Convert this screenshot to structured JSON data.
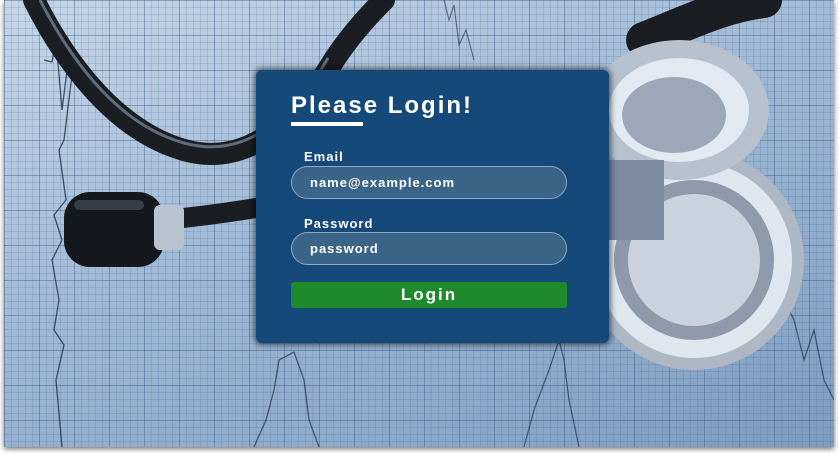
{
  "login": {
    "title": "Please Login!",
    "email_label": "Email",
    "email_value": "name@example.com",
    "password_label": "Password",
    "password_value": "password",
    "login_button": "Login"
  },
  "colors": {
    "panel": "#15497a",
    "input_bg": "#3b6489",
    "button": "#1e8a2c",
    "background_tint": "#9fb8d4"
  },
  "background": {
    "icon": "stethoscope-on-ecg-paper"
  }
}
